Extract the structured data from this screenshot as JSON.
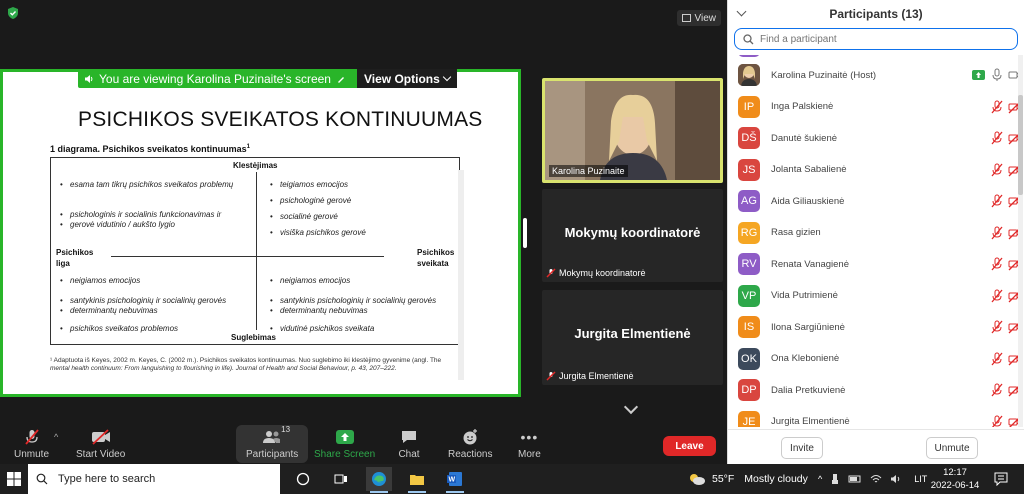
{
  "topbar": {
    "view_label": "View"
  },
  "share": {
    "banner_text": "You are viewing Karolina Puzinaite's screen",
    "view_options": "View Options"
  },
  "document": {
    "title": "PSICHIKOS SVEIKATOS KONTINUUMAS",
    "subtitle": "1 diagrama. Psichikos sveikatos kontinuumas",
    "subtitle_sup": "1",
    "top_label": "Klestėjimas",
    "bottom_label": "Suglebimas",
    "left_label_1": "Psichikos",
    "left_label_2": "liga",
    "right_label_1": "Psichikos",
    "right_label_2": "sveikata",
    "q1": [
      "esama tam tikrų psichikos sveikatos problemų",
      "psichologinis ir socialinis funkcionavimas ir",
      "gerovė vidutinio / aukšto lygio"
    ],
    "q2": [
      "teigiamos emocijos",
      "psichologinė gerovė",
      "socialinė gerovė",
      "visiška psichikos gerovė"
    ],
    "q3": [
      "neigiamos emocijos",
      "santykinis psichologinių ir socialinių gerovės",
      "determinantų nebuvimas",
      "psichikos sveikatos problemos"
    ],
    "q4": [
      "neigiamos emocijos",
      "santykinis psichologinių ir socialinių gerovės",
      "determinantų nebuvimas",
      "vidutinė psichikos sveikata"
    ],
    "footnote_1": "¹ Adaptuota iš Keyes, 2002 m. Keyes, C. (2002 m.). Psichikos sveikatos kontinuumas. Nuo suglebimo iki klestėjimo gyvenime (angl. The",
    "footnote_2": "mental health continuum: From languishing to flourishing in life). Journal of Health and Social Behaviour, p. 43, 207–222."
  },
  "tiles": [
    {
      "name": "Karolina Puzinaite"
    },
    {
      "big": "Mokymų koordinatorė",
      "small": "Mokymų koordinatorė"
    },
    {
      "big": "Jurgita Elmentienė",
      "small": "Jurgita Elmentienė"
    }
  ],
  "toolbar": {
    "unmute": "Unmute",
    "start_video": "Start Video",
    "participants": "Participants",
    "participants_count": "13",
    "share_screen": "Share Screen",
    "chat": "Chat",
    "reactions": "Reactions",
    "more": "More",
    "leave": "Leave"
  },
  "panel": {
    "title": "Participants (13)",
    "search_placeholder": "Find a participant",
    "invite": "Invite",
    "unmute": "Unmute",
    "participants": [
      {
        "initials": "",
        "name": "Karolina Puzinaitė (Host)",
        "color": "#7b5b44"
      },
      {
        "initials": "IP",
        "name": "Inga Palskienė",
        "color": "#f08c1a"
      },
      {
        "initials": "DŠ",
        "name": "Danutė šukienė",
        "color": "#d9463f"
      },
      {
        "initials": "JS",
        "name": "Jolanta Sabalienė",
        "color": "#d9463f"
      },
      {
        "initials": "AG",
        "name": "Aida Giliauskienė",
        "color": "#8e5cc6"
      },
      {
        "initials": "RG",
        "name": "Rasa gizien",
        "color": "#f5a623"
      },
      {
        "initials": "RV",
        "name": "Renata Vanagienė",
        "color": "#8e5cc6"
      },
      {
        "initials": "VP",
        "name": "Vida Putrimienė",
        "color": "#2ea84a"
      },
      {
        "initials": "IS",
        "name": "Ilona Sargiūnienė",
        "color": "#f08c1a"
      },
      {
        "initials": "OK",
        "name": "Ona Klebonienė",
        "color": "#3c4a5c"
      },
      {
        "initials": "DP",
        "name": "Dalia Pretkuvienė",
        "color": "#d9463f"
      },
      {
        "initials": "JE",
        "name": "Jurgita Elmentienė",
        "color": "#f08c1a"
      }
    ]
  },
  "taskbar": {
    "search_placeholder": "Type here to search",
    "weather_temp": "55°F",
    "weather_text": "Mostly cloudy",
    "lang": "LIT",
    "time": "12:17",
    "date": "2022-06-14"
  }
}
